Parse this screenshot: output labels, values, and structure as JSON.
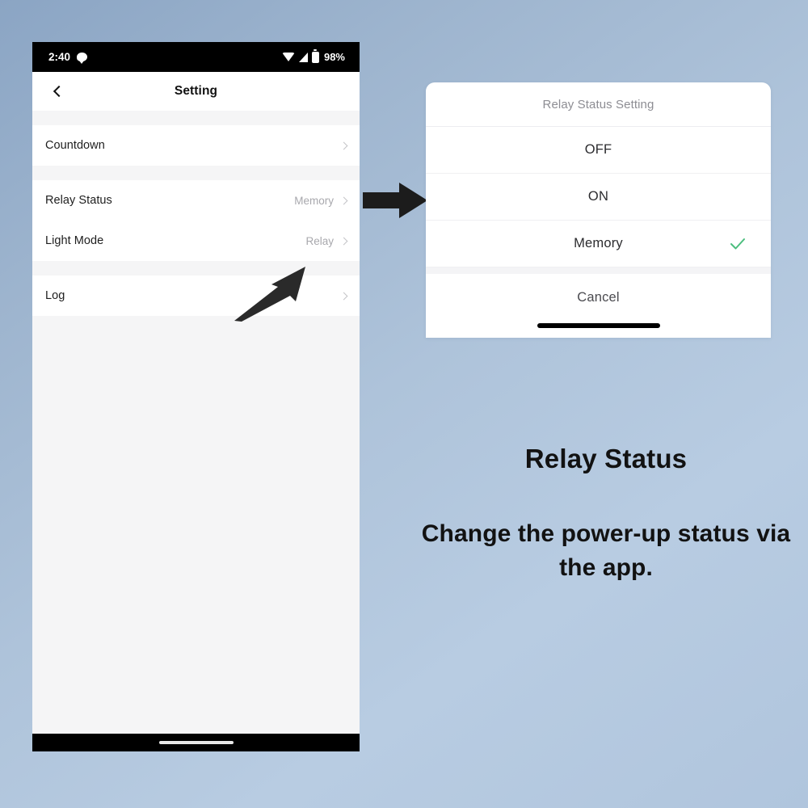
{
  "background": {
    "top_color": "#8ba5c4",
    "bottom_color": "#b0c5dd"
  },
  "phone": {
    "status_bar": {
      "time": "2:40",
      "notification_icon": "speech-bubble-icon",
      "wifi_icon": "wifi-icon",
      "signal_icon": "cell-signal-icon",
      "battery_icon": "battery-icon",
      "battery_percent": "98%"
    },
    "nav_bar": {
      "back_icon": "chevron-left-icon",
      "title": "Setting"
    },
    "groups": [
      {
        "rows": [
          {
            "label": "Countdown",
            "value": "",
            "chevron": "chevron-right-icon"
          }
        ]
      },
      {
        "rows": [
          {
            "label": "Relay Status",
            "value": "Memory",
            "chevron": "chevron-right-icon"
          },
          {
            "label": "Light Mode",
            "value": "Relay",
            "chevron": "chevron-right-icon"
          }
        ]
      },
      {
        "rows": [
          {
            "label": "Log",
            "value": "",
            "chevron": "chevron-right-icon"
          }
        ]
      }
    ],
    "annotation_arrow": "pointer-arrow-to-memory",
    "home_indicator": "home-indicator-pill"
  },
  "flow_arrow": {
    "icon": "right-block-arrow-icon",
    "color": "#1c1c1c"
  },
  "dialog": {
    "header": "Relay Status Setting",
    "options": [
      {
        "label": "OFF",
        "selected": false
      },
      {
        "label": "ON",
        "selected": false
      },
      {
        "label": "Memory",
        "selected": true
      }
    ],
    "check_icon": "check-icon",
    "check_color": "#4cbe7e",
    "cancel_label": "Cancel",
    "home_indicator": "home-indicator-bar"
  },
  "caption": {
    "title": "Relay Status",
    "body": "Change the power-up status via the app."
  }
}
